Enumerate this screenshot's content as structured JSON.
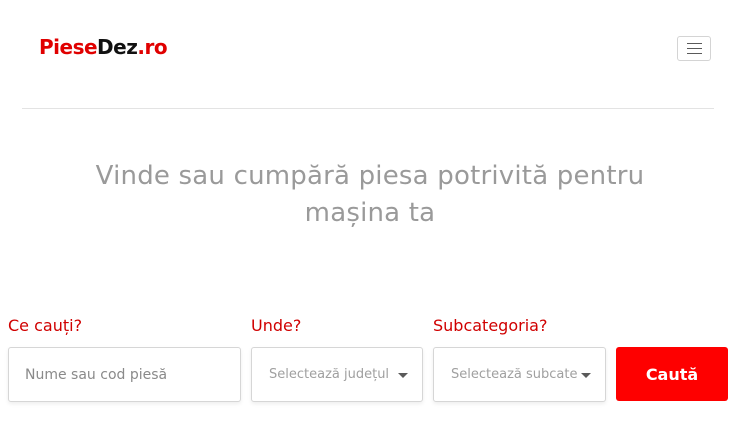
{
  "header": {
    "logo_part1": "Piese",
    "logo_part2": "Dez",
    "logo_part3": ".ro",
    "menu_icon": "hamburger-icon"
  },
  "hero": {
    "line1": "Vinde sau cumpără piesa potrivită pentru",
    "line2": "mașina ta"
  },
  "search": {
    "what_label": "Ce cauți?",
    "what_placeholder": "Nume sau cod piesă",
    "where_label": "Unde?",
    "where_selected": "Selectează județul",
    "subcat_label": "Subcategoria?",
    "subcat_selected": "Selectează subcategoria",
    "submit_label": "Caută"
  },
  "colors": {
    "brand_red": "#e00000",
    "button_red": "#fe0000",
    "label_red": "#d00000",
    "hero_text": "#9a9a9a"
  }
}
